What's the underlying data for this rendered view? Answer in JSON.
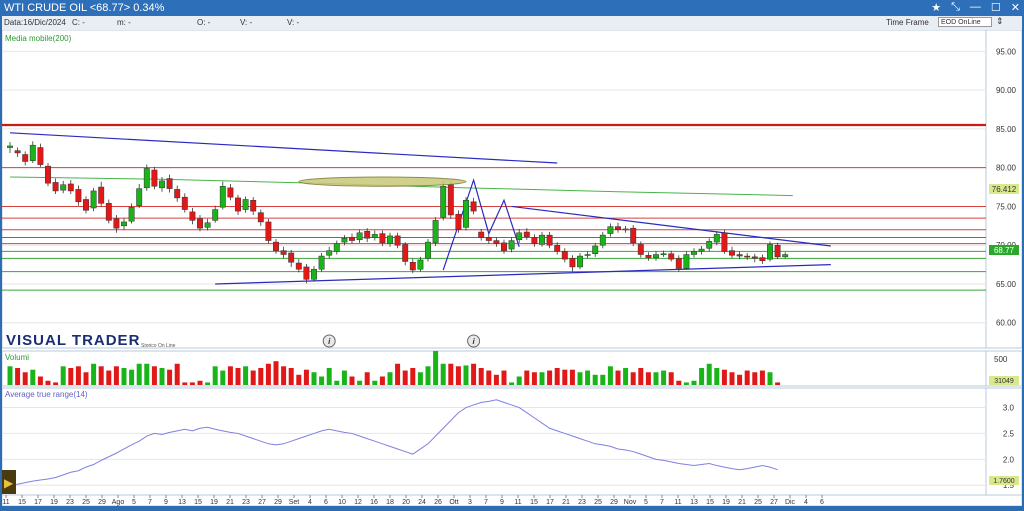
{
  "window": {
    "title": "WTI CRUDE OIL <68.77> 0.34%",
    "buttons": [
      "★",
      "⤡",
      "—",
      "☐",
      "✕"
    ]
  },
  "toolbar": {
    "date": "Data:16/Dic/2024",
    "c": "C: -",
    "m": "m: -",
    "o": "O: -",
    "v1": "V: -",
    "v2": "V: -",
    "timeframe_label": "Time Frame",
    "timeframe_value": "EOD OnLine"
  },
  "chart_data": {
    "type": "candlestick",
    "indicator_label": "Media mobile(200)",
    "price_ticks": [
      "95.00",
      "90.00",
      "85.00",
      "80.00",
      "75.00",
      "70.00",
      "65.00",
      "60.00"
    ],
    "price_range": [
      57,
      97.5
    ],
    "last_price_label": "68.77",
    "ma_price_label": "76.412",
    "brand": "VISUAL TRADER",
    "brand_sub": "Storico On Line",
    "volume_label": "Volumi",
    "volume_tick": "500",
    "volume_value_label": "31049",
    "atr_label": "Average true range(14)",
    "atr_ticks": [
      "3.0",
      "2.5",
      "2.0",
      "1.5"
    ],
    "atr_range": [
      1.35,
      3.3
    ],
    "atr_value_label": "1.7600",
    "x_labels": [
      "11",
      "15",
      "17",
      "19",
      "23",
      "25",
      "29",
      "Ago",
      "5",
      "7",
      "9",
      "13",
      "15",
      "19",
      "21",
      "23",
      "27",
      "29",
      "Set",
      "4",
      "6",
      "10",
      "12",
      "16",
      "18",
      "20",
      "24",
      "26",
      "Ott",
      "3",
      "7",
      "9",
      "11",
      "15",
      "17",
      "21",
      "23",
      "25",
      "29",
      "Nov",
      "5",
      "7",
      "11",
      "13",
      "15",
      "19",
      "21",
      "25",
      "27",
      "Dic",
      "4",
      "6"
    ],
    "candles": [
      {
        "o": 82.6,
        "c": 82.8,
        "h": 83.3,
        "l": 81.9
      },
      {
        "o": 82.2,
        "c": 81.9,
        "h": 82.6,
        "l": 81.4
      },
      {
        "o": 81.7,
        "c": 80.8,
        "h": 82.1,
        "l": 80.3
      },
      {
        "o": 80.9,
        "c": 82.9,
        "h": 83.4,
        "l": 80.6
      },
      {
        "o": 82.6,
        "c": 80.4,
        "h": 83.1,
        "l": 80.1
      },
      {
        "o": 80.2,
        "c": 78.0,
        "h": 80.6,
        "l": 77.6
      },
      {
        "o": 78.1,
        "c": 77.0,
        "h": 78.6,
        "l": 76.6
      },
      {
        "o": 77.1,
        "c": 77.8,
        "h": 78.3,
        "l": 76.7
      },
      {
        "o": 77.9,
        "c": 77.0,
        "h": 78.4,
        "l": 76.6
      },
      {
        "o": 77.2,
        "c": 75.6,
        "h": 77.7,
        "l": 75.1
      },
      {
        "o": 75.9,
        "c": 74.5,
        "h": 76.3,
        "l": 74.1
      },
      {
        "o": 74.8,
        "c": 77.0,
        "h": 77.4,
        "l": 74.4
      },
      {
        "o": 77.5,
        "c": 75.4,
        "h": 78.2,
        "l": 75.0
      },
      {
        "o": 75.4,
        "c": 73.2,
        "h": 75.9,
        "l": 72.8
      },
      {
        "o": 73.4,
        "c": 72.2,
        "h": 73.9,
        "l": 71.6
      },
      {
        "o": 72.5,
        "c": 73.0,
        "h": 73.5,
        "l": 72.0
      },
      {
        "o": 73.1,
        "c": 74.9,
        "h": 75.4,
        "l": 72.8
      },
      {
        "o": 75.1,
        "c": 77.3,
        "h": 77.9,
        "l": 74.8
      },
      {
        "o": 77.4,
        "c": 79.9,
        "h": 80.4,
        "l": 77.0
      },
      {
        "o": 79.7,
        "c": 77.6,
        "h": 80.1,
        "l": 77.2
      },
      {
        "o": 77.4,
        "c": 78.3,
        "h": 78.8,
        "l": 76.9
      },
      {
        "o": 78.6,
        "c": 77.3,
        "h": 79.1,
        "l": 76.8
      },
      {
        "o": 77.2,
        "c": 76.1,
        "h": 77.7,
        "l": 75.6
      },
      {
        "o": 76.2,
        "c": 74.6,
        "h": 76.7,
        "l": 74.2
      },
      {
        "o": 74.3,
        "c": 73.2,
        "h": 74.8,
        "l": 72.7
      },
      {
        "o": 73.4,
        "c": 72.2,
        "h": 73.9,
        "l": 71.8
      },
      {
        "o": 72.3,
        "c": 72.9,
        "h": 73.4,
        "l": 71.9
      },
      {
        "o": 73.2,
        "c": 74.6,
        "h": 75.1,
        "l": 72.9
      },
      {
        "o": 74.9,
        "c": 77.6,
        "h": 78.2,
        "l": 74.6
      },
      {
        "o": 77.4,
        "c": 76.2,
        "h": 77.9,
        "l": 75.8
      },
      {
        "o": 76.1,
        "c": 74.4,
        "h": 76.5,
        "l": 73.9
      },
      {
        "o": 74.6,
        "c": 75.9,
        "h": 76.3,
        "l": 74.2
      },
      {
        "o": 75.8,
        "c": 74.4,
        "h": 76.2,
        "l": 73.9
      },
      {
        "o": 74.2,
        "c": 73.0,
        "h": 74.6,
        "l": 72.5
      },
      {
        "o": 73.0,
        "c": 70.6,
        "h": 73.4,
        "l": 70.2
      },
      {
        "o": 70.4,
        "c": 69.3,
        "h": 70.8,
        "l": 68.9
      },
      {
        "o": 69.3,
        "c": 68.8,
        "h": 69.8,
        "l": 68.3
      },
      {
        "o": 69.0,
        "c": 67.8,
        "h": 69.4,
        "l": 67.2
      },
      {
        "o": 67.7,
        "c": 66.9,
        "h": 68.2,
        "l": 66.5
      },
      {
        "o": 67.2,
        "c": 65.6,
        "h": 67.6,
        "l": 65.1
      },
      {
        "o": 65.6,
        "c": 66.9,
        "h": 67.3,
        "l": 65.3
      },
      {
        "o": 66.9,
        "c": 68.6,
        "h": 69.0,
        "l": 66.6
      },
      {
        "o": 68.7,
        "c": 69.3,
        "h": 69.8,
        "l": 68.3
      },
      {
        "o": 69.2,
        "c": 70.2,
        "h": 70.6,
        "l": 68.8
      },
      {
        "o": 70.4,
        "c": 70.9,
        "h": 71.3,
        "l": 70.0
      },
      {
        "o": 71.0,
        "c": 70.6,
        "h": 71.5,
        "l": 70.2
      },
      {
        "o": 70.7,
        "c": 71.6,
        "h": 72.0,
        "l": 70.3
      },
      {
        "o": 71.8,
        "c": 70.9,
        "h": 72.2,
        "l": 70.4
      },
      {
        "o": 71.0,
        "c": 71.4,
        "h": 71.9,
        "l": 70.6
      },
      {
        "o": 71.5,
        "c": 70.3,
        "h": 71.9,
        "l": 69.9
      },
      {
        "o": 70.2,
        "c": 71.2,
        "h": 71.6,
        "l": 69.8
      },
      {
        "o": 71.2,
        "c": 70.0,
        "h": 71.6,
        "l": 69.6
      },
      {
        "o": 70.1,
        "c": 67.9,
        "h": 70.4,
        "l": 67.4
      },
      {
        "o": 67.8,
        "c": 66.8,
        "h": 68.3,
        "l": 66.4
      },
      {
        "o": 66.9,
        "c": 68.1,
        "h": 68.5,
        "l": 66.6
      },
      {
        "o": 68.3,
        "c": 70.4,
        "h": 70.8,
        "l": 67.9
      },
      {
        "o": 70.3,
        "c": 73.2,
        "h": 73.6,
        "l": 69.9
      },
      {
        "o": 73.6,
        "c": 77.6,
        "h": 78.3,
        "l": 73.2
      },
      {
        "o": 77.8,
        "c": 73.9,
        "h": 78.3,
        "l": 73.4
      },
      {
        "o": 74.0,
        "c": 72.0,
        "h": 74.5,
        "l": 71.6
      },
      {
        "o": 72.3,
        "c": 75.8,
        "h": 76.2,
        "l": 71.9
      },
      {
        "o": 75.6,
        "c": 74.4,
        "h": 76.1,
        "l": 74.0
      },
      {
        "o": 71.7,
        "c": 71.0,
        "h": 72.1,
        "l": 70.6
      },
      {
        "o": 71.0,
        "c": 70.6,
        "h": 71.4,
        "l": 70.2
      },
      {
        "o": 70.6,
        "c": 70.2,
        "h": 71.0,
        "l": 69.8
      },
      {
        "o": 70.3,
        "c": 69.3,
        "h": 70.7,
        "l": 68.9
      },
      {
        "o": 69.5,
        "c": 70.6,
        "h": 71.0,
        "l": 69.1
      },
      {
        "o": 70.7,
        "c": 71.6,
        "h": 72.1,
        "l": 70.3
      },
      {
        "o": 71.7,
        "c": 71.1,
        "h": 72.2,
        "l": 70.7
      },
      {
        "o": 71.0,
        "c": 70.2,
        "h": 71.4,
        "l": 69.8
      },
      {
        "o": 70.1,
        "c": 71.3,
        "h": 71.7,
        "l": 69.8
      },
      {
        "o": 71.3,
        "c": 70.0,
        "h": 71.7,
        "l": 69.6
      },
      {
        "o": 70.0,
        "c": 69.2,
        "h": 70.4,
        "l": 68.8
      },
      {
        "o": 69.2,
        "c": 68.2,
        "h": 69.6,
        "l": 67.8
      },
      {
        "o": 68.3,
        "c": 67.2,
        "h": 68.7,
        "l": 66.6
      },
      {
        "o": 67.2,
        "c": 68.6,
        "h": 69.0,
        "l": 66.9
      },
      {
        "o": 68.7,
        "c": 68.8,
        "h": 69.2,
        "l": 68.3
      },
      {
        "o": 68.9,
        "c": 69.9,
        "h": 70.3,
        "l": 68.5
      },
      {
        "o": 70.0,
        "c": 71.3,
        "h": 71.7,
        "l": 69.6
      },
      {
        "o": 71.5,
        "c": 72.4,
        "h": 72.8,
        "l": 71.1
      },
      {
        "o": 72.4,
        "c": 72.0,
        "h": 72.9,
        "l": 71.6
      },
      {
        "o": 72.0,
        "c": 72.1,
        "h": 72.5,
        "l": 71.6
      },
      {
        "o": 72.2,
        "c": 70.3,
        "h": 72.6,
        "l": 69.9
      },
      {
        "o": 70.1,
        "c": 68.8,
        "h": 70.5,
        "l": 68.4
      },
      {
        "o": 68.7,
        "c": 68.4,
        "h": 69.1,
        "l": 68.0
      },
      {
        "o": 68.4,
        "c": 68.8,
        "h": 69.2,
        "l": 68.0
      },
      {
        "o": 68.9,
        "c": 68.9,
        "h": 69.3,
        "l": 68.5
      },
      {
        "o": 68.9,
        "c": 68.2,
        "h": 69.3,
        "l": 67.9
      },
      {
        "o": 68.3,
        "c": 67.0,
        "h": 68.7,
        "l": 66.6
      },
      {
        "o": 67.0,
        "c": 68.8,
        "h": 69.2,
        "l": 66.8
      },
      {
        "o": 68.8,
        "c": 69.2,
        "h": 69.6,
        "l": 68.4
      },
      {
        "o": 69.2,
        "c": 69.5,
        "h": 69.9,
        "l": 68.8
      },
      {
        "o": 69.6,
        "c": 70.5,
        "h": 70.9,
        "l": 69.2
      },
      {
        "o": 70.4,
        "c": 71.4,
        "h": 71.8,
        "l": 70.0
      },
      {
        "o": 71.6,
        "c": 69.2,
        "h": 72.0,
        "l": 68.9
      },
      {
        "o": 69.3,
        "c": 68.7,
        "h": 69.8,
        "l": 68.3
      },
      {
        "o": 68.8,
        "c": 68.6,
        "h": 69.2,
        "l": 68.2
      },
      {
        "o": 68.6,
        "c": 68.5,
        "h": 69.0,
        "l": 68.1
      },
      {
        "o": 68.5,
        "c": 68.3,
        "h": 68.9,
        "l": 67.8
      },
      {
        "o": 68.4,
        "c": 68.0,
        "h": 68.8,
        "l": 67.6
      },
      {
        "o": 68.2,
        "c": 70.1,
        "h": 70.5,
        "l": 67.9
      },
      {
        "o": 70.0,
        "c": 68.5,
        "h": 70.3,
        "l": 68.2
      },
      {
        "o": 68.5,
        "c": 68.8,
        "h": 69.1,
        "l": 68.3
      }
    ],
    "horizontal_lines": [
      {
        "price": 85.5,
        "color": "#d01818",
        "width": 2.2
      },
      {
        "price": 80.0,
        "color": "#d84040",
        "width": 1
      },
      {
        "price": 75.0,
        "color": "#d84040",
        "width": 1
      },
      {
        "price": 73.5,
        "color": "#d84040",
        "width": 1
      },
      {
        "price": 72.0,
        "color": "#d84040",
        "width": 1
      },
      {
        "price": 71.0,
        "color": "#d84040",
        "width": 1
      },
      {
        "price": 70.2,
        "color": "#d84040",
        "width": 1
      },
      {
        "price": 69.2,
        "color": "#3aa63a",
        "width": 1
      },
      {
        "price": 68.3,
        "color": "#3aa63a",
        "width": 1
      },
      {
        "price": 66.6,
        "color": "#3aa63a",
        "width": 1
      },
      {
        "price": 64.2,
        "color": "#3aa63a",
        "width": 1
      }
    ],
    "ma_line": [
      [
        0,
        78.8
      ],
      [
        20,
        78.5
      ],
      [
        40,
        78.0
      ],
      [
        60,
        77.4
      ],
      [
        80,
        76.9
      ],
      [
        103,
        76.4
      ]
    ],
    "trend_lines": [
      {
        "from": [
          0,
          84.5
        ],
        "to": [
          72,
          80.6
        ]
      },
      {
        "from": [
          27,
          65.0
        ],
        "to": [
          108,
          67.5
        ]
      },
      {
        "from": [
          66,
          75.0
        ],
        "to": [
          108,
          69.9
        ]
      }
    ],
    "zigzag": [
      [
        57,
        66.8
      ],
      [
        61,
        78.4
      ],
      [
        63,
        71.5
      ],
      [
        65,
        75.8
      ],
      [
        67,
        69.8
      ]
    ],
    "ellipse": {
      "center": [
        49,
        78.2
      ],
      "rx_bars": 11,
      "ry_price": 0.6
    },
    "info_icons_at": [
      42,
      61
    ],
    "volumes": [
      22,
      20,
      15,
      18,
      10,
      5,
      3,
      22,
      20,
      22,
      15,
      25,
      22,
      17,
      22,
      20,
      18,
      25,
      25,
      22,
      20,
      18,
      25,
      3,
      3,
      5,
      3,
      22,
      17,
      22,
      20,
      22,
      17,
      20,
      25,
      28,
      22,
      20,
      12,
      18,
      15,
      10,
      20,
      5,
      17,
      10,
      5,
      15,
      5,
      10,
      15,
      25,
      17,
      20,
      15,
      22,
      40,
      25,
      25,
      22,
      23,
      25,
      20,
      17,
      12,
      17,
      3,
      10,
      17,
      15,
      15,
      17,
      20,
      18,
      18,
      15,
      17,
      12,
      12,
      22,
      17,
      20,
      15,
      20,
      15,
      15,
      17,
      15,
      5,
      3,
      5,
      20,
      25,
      20,
      18,
      15,
      12,
      17,
      15,
      17,
      15,
      3
    ],
    "atr": [
      1.5,
      1.52,
      1.55,
      1.58,
      1.6,
      1.62,
      1.65,
      1.7,
      1.75,
      1.78,
      1.85,
      1.9,
      1.98,
      2.05,
      2.12,
      2.2,
      2.28,
      2.35,
      2.45,
      2.5,
      2.48,
      2.52,
      2.55,
      2.58,
      2.55,
      2.6,
      2.62,
      2.58,
      2.55,
      2.52,
      2.5,
      2.45,
      2.4,
      2.35,
      2.3,
      2.28,
      2.3,
      2.35,
      2.4,
      2.45,
      2.5,
      2.55,
      2.58,
      2.55,
      2.52,
      2.5,
      2.45,
      2.4,
      2.35,
      2.3,
      2.25,
      2.2,
      2.15,
      2.1,
      2.2,
      2.3,
      2.45,
      2.6,
      2.75,
      2.9,
      3.0,
      3.05,
      3.1,
      3.12,
      3.15,
      3.1,
      3.05,
      3.0,
      2.9,
      2.8,
      2.7,
      2.6,
      2.55,
      2.5,
      2.45,
      2.4,
      2.35,
      2.3,
      2.28,
      2.25,
      2.2,
      2.18,
      2.15,
      2.1,
      2.05,
      2.0,
      1.98,
      1.95,
      1.92,
      1.9,
      1.88,
      1.9,
      1.92,
      1.88,
      1.85,
      1.82,
      1.8,
      1.82,
      1.85,
      1.88,
      1.85,
      1.8
    ],
    "colors": {
      "up": "#18b418",
      "down": "#e01818",
      "ma": "#48b448",
      "trend": "#2a2ac0",
      "atr": "#8080e0",
      "brand": "#1b2e72"
    }
  }
}
